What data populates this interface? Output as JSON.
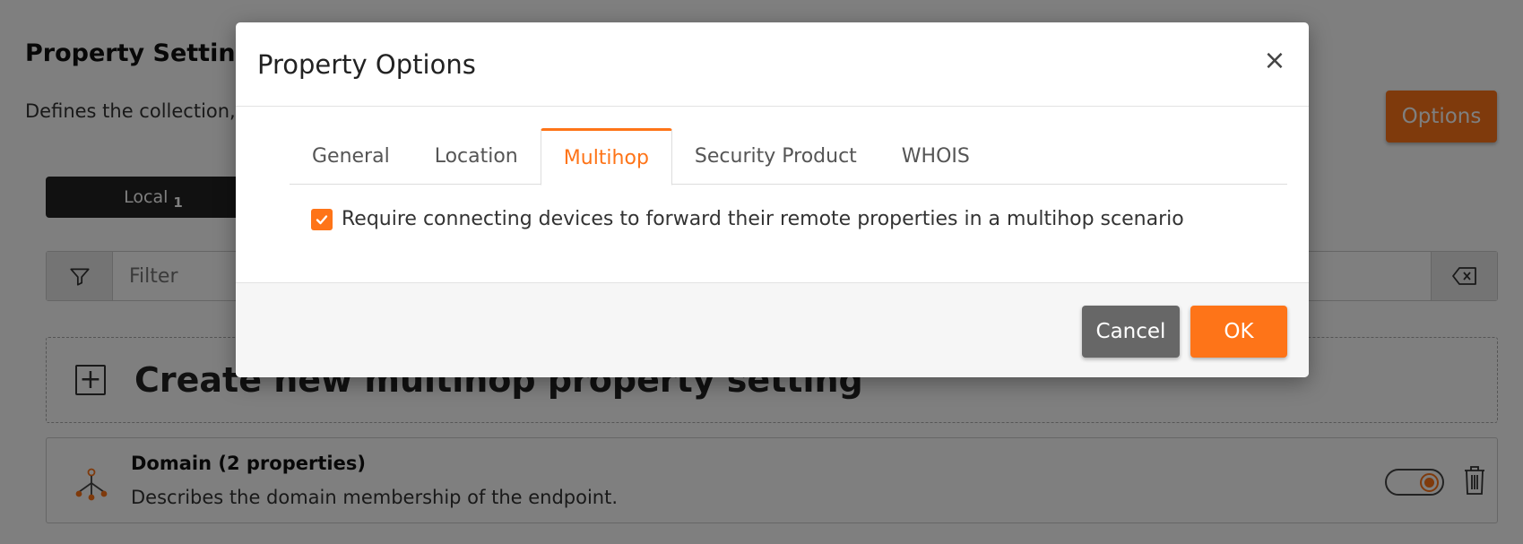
{
  "page": {
    "title": "Property Settings",
    "description": "Defines the collection, override the default be",
    "options_label": "Options",
    "segment": {
      "label": "Local",
      "count": "1"
    },
    "filter": {
      "placeholder": "Filter"
    },
    "create": {
      "label": "Create new multihop property setting"
    },
    "property": {
      "title": "Domain (2 properties)",
      "description": "Describes the domain membership of the endpoint.",
      "enabled": true
    }
  },
  "modal": {
    "title": "Property Options",
    "close_glyph": "×",
    "tabs": [
      {
        "label": "General",
        "active": false
      },
      {
        "label": "Location",
        "active": false
      },
      {
        "label": "Multihop",
        "active": true
      },
      {
        "label": "Security Product",
        "active": false
      },
      {
        "label": "WHOIS",
        "active": false
      }
    ],
    "checkbox": {
      "label": "Require connecting devices to forward their remote properties in a multihop scenario",
      "checked": true
    },
    "footer": {
      "cancel_label": "Cancel",
      "ok_label": "OK"
    }
  },
  "colors": {
    "accent": "#fe7418",
    "cancel": "#676767",
    "overlay": "rgba(0,0,0,0.5)"
  },
  "icons": [
    "filter-icon",
    "clear-filter-icon",
    "plus-square-icon",
    "domain-network-icon",
    "trash-icon",
    "close-icon",
    "checkmark-icon"
  ]
}
